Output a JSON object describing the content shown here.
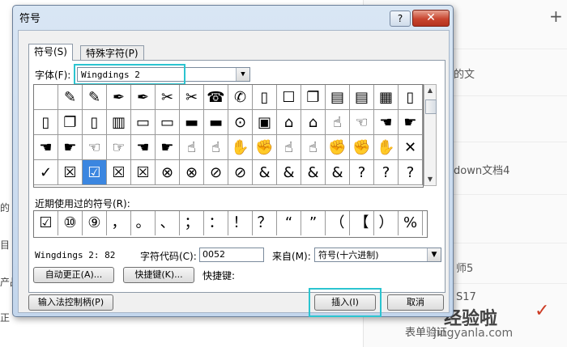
{
  "background": {
    "right_texts": [
      "的文",
      "down文档4",
      "师5",
      "S17",
      "表单验证"
    ],
    "left_texts": [
      "的",
      "目",
      "产品",
      "正"
    ],
    "plus_glyph": "+"
  },
  "watermark": {
    "text": "经验啦",
    "url": "jingyanla.com"
  },
  "dialog": {
    "title": "符号",
    "help_glyph": "?",
    "close_glyph": "✕",
    "tabs": [
      {
        "label": "符号(S)",
        "active": true
      },
      {
        "label": "特殊字符(P)",
        "active": false
      }
    ],
    "font_label": "字体(F):",
    "font_value": "Wingdings 2",
    "symbols": [
      [
        "",
        "✎",
        "✎",
        "✒",
        "✒",
        "✂",
        "✂",
        "☎",
        "✆",
        "▯",
        "☐",
        "❐",
        "▤",
        "▤",
        "▦",
        "▯"
      ],
      [
        "▯",
        "❐",
        "▯",
        "▥",
        "▭",
        "▭",
        "▬",
        "▬",
        "⊙",
        "▣",
        "⌂",
        "⌂",
        "☝",
        "☜",
        "☚",
        "☛"
      ],
      [
        "☚",
        "☛",
        "☜",
        "☞",
        "☚",
        "☛",
        "☝",
        "☝",
        "✋",
        "✊",
        "☝",
        "☝",
        "✊",
        "✊",
        "✋",
        "✕"
      ],
      [
        "✓",
        "☒",
        "☑",
        "☒",
        "☒",
        "⊗",
        "⊗",
        "⊘",
        "⊘",
        "&",
        "&",
        "&",
        "&",
        "?",
        "?",
        "?"
      ]
    ],
    "selected_symbol": {
      "row": 3,
      "col": 2
    },
    "recent_label": "近期使用过的符号(R):",
    "recent_symbols": [
      "☑",
      "⑩",
      "⑨",
      "，",
      "。",
      "、",
      "；",
      "：",
      "！",
      "？",
      "“",
      "”",
      "（",
      "【",
      "）",
      "%"
    ],
    "char_name": "Wingdings 2: 82",
    "char_code_label": "字符代码(C):",
    "char_code": "0052",
    "from_label": "来自(M):",
    "from_value": "符号(十六进制)",
    "autocorrect_label": "自动更正(A)...",
    "shortcut_key_label": "快捷键(K)...",
    "shortcut_text": "快捷键:",
    "ime_label": "输入法控制柄(P)",
    "insert_label": "插入(I)",
    "cancel_label": "取消",
    "highlight_color": "#2bc4d0"
  }
}
